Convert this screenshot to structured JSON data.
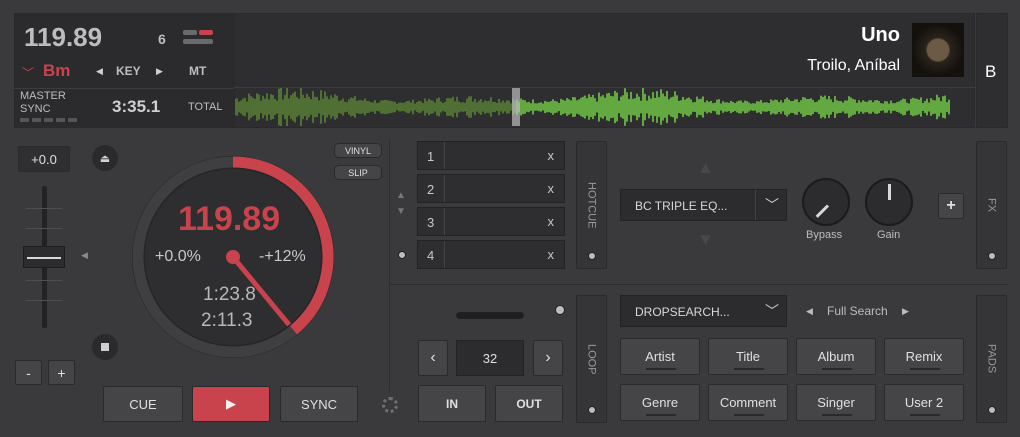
{
  "deck": {
    "letter": "B",
    "bpm": "119.89",
    "number": "6",
    "key": "Bm",
    "key_label": "KEY",
    "key_mode": "MT",
    "master_label": "MASTER",
    "sync_label": "SYNC",
    "total_time": "3:35.1",
    "total_label": "TOTAL",
    "title": "Uno",
    "artist": "Troilo, Aníbal",
    "pitch_value": "+0.0",
    "vinyl_label": "VINYL",
    "slip_label": "SLIP",
    "pitch_percent": "+0.0%",
    "pitch_range": "-+12%",
    "elapsed": "1:23.8",
    "remaining": "2:11.3",
    "progress": 0.39,
    "minus_label": "-",
    "plus_label": "+",
    "cue_label": "CUE",
    "sync_button_label": "SYNC"
  },
  "hotcues": {
    "tab_label": "HOTCUE",
    "slots": [
      {
        "num": "1",
        "x": "x"
      },
      {
        "num": "2",
        "x": "x"
      },
      {
        "num": "3",
        "x": "x"
      },
      {
        "num": "4",
        "x": "x"
      }
    ]
  },
  "fx": {
    "tab_label": "FX",
    "selected": "BC TRIPLE EQ...",
    "knob1_label": "Bypass",
    "knob2_label": "Gain",
    "add_label": "+"
  },
  "loop": {
    "tab_label": "LOOP",
    "size": "32",
    "in_label": "IN",
    "out_label": "OUT"
  },
  "pads": {
    "tab_label": "PADS",
    "selected": "DROPSEARCH...",
    "mode": "Full Search",
    "buttons": [
      "Artist",
      "Title",
      "Album",
      "Remix",
      "Genre",
      "Comment",
      "Singer",
      "User 2"
    ]
  },
  "colors": {
    "accent_red": "#c9434d",
    "waveform_green": "#7bdc4a",
    "background": "#3a3a3c"
  }
}
